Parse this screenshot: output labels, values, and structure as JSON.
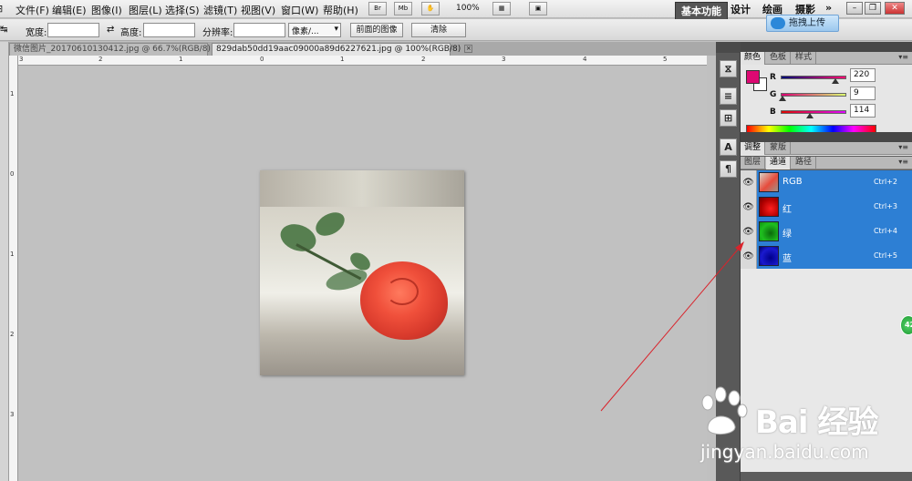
{
  "menubar": {
    "items": [
      "文件(F)",
      "编辑(E)",
      "图像(I)",
      "图层(L)",
      "选择(S)",
      "滤镜(T)",
      "视图(V)",
      "窗口(W)",
      "帮助(H)"
    ],
    "br_label": "Br",
    "mb_label": "Mb",
    "zoom": "100%",
    "more": "»",
    "workspaces": [
      "基本功能",
      "设计",
      "绘画",
      "摄影"
    ],
    "workspace_more": "»"
  },
  "float_button": {
    "label": "拖拽上传"
  },
  "optbar": {
    "width_label": "宽度:",
    "height_label": "高度:",
    "resolution_label": "分辨率:",
    "unit_select": "像素/...",
    "front_image_button": "前面的图像",
    "clear_button": "清除",
    "swap": "⇄"
  },
  "tabs": [
    {
      "title": "微信图片_20170610130412.jpg @ 66.7%(RGB/8)",
      "close": "×"
    },
    {
      "title": "829dab50dd19aac09000a89d6227621.jpg @ 100%(RGB/8)",
      "close": "×"
    }
  ],
  "ruler": {
    "h_labels": [
      "3",
      "2",
      "1",
      "0",
      "1",
      "2",
      "3",
      "4",
      "5"
    ],
    "v_labels": [
      "1",
      "0",
      "1",
      "2",
      "3"
    ]
  },
  "color_panel": {
    "tabs": [
      "颜色",
      "色板",
      "样式"
    ],
    "fg_color": "#dc0972",
    "channels": [
      {
        "label": "R",
        "value": "220"
      },
      {
        "label": "G",
        "value": "9"
      },
      {
        "label": "B",
        "value": "114"
      }
    ]
  },
  "adjust_panel": {
    "tabs": [
      "调整",
      "蒙版"
    ]
  },
  "layers_panel": {
    "tabs": [
      "图层",
      "通道",
      "路径"
    ],
    "channels": [
      {
        "name": "RGB",
        "shortcut": "Ctrl+2"
      },
      {
        "name": "红",
        "shortcut": "Ctrl+3"
      },
      {
        "name": "绿",
        "shortcut": "Ctrl+4"
      },
      {
        "name": "蓝",
        "shortcut": "Ctrl+5"
      }
    ]
  },
  "dock_icons": [
    "⧖",
    "≡",
    "⊞",
    "A",
    "¶"
  ],
  "badge": {
    "value": "42"
  },
  "watermark": {
    "brand": "Bai  经验",
    "url": "jingyan.baidu.com"
  },
  "colors": {
    "accent_blue": "#2d7fd4",
    "annotation_red": "#d9232b"
  }
}
